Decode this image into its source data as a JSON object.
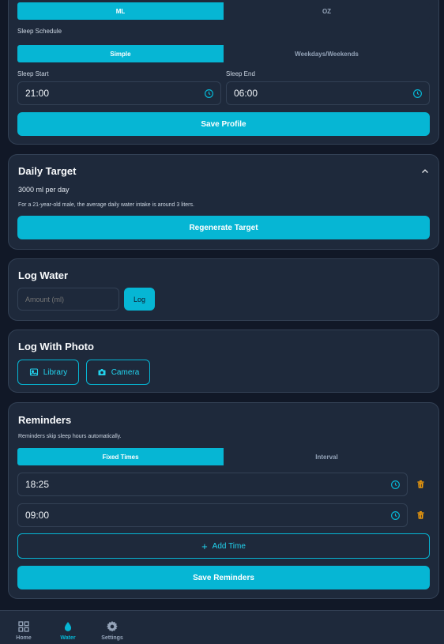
{
  "profile": {
    "units": {
      "options": [
        "ML",
        "OZ"
      ],
      "selected": "ML"
    },
    "sleep_schedule_label": "Sleep Schedule",
    "sleep_schedule": {
      "options": [
        "Simple",
        "Weekdays/Weekends"
      ],
      "selected": "Simple"
    },
    "sleep_start_label": "Sleep Start",
    "sleep_start_value": "21:00",
    "sleep_end_label": "Sleep End",
    "sleep_end_value": "06:00",
    "save_label": "Save Profile"
  },
  "daily_target": {
    "title": "Daily Target",
    "amount_text": "3000 ml per day",
    "note": "For a 21-year-old male, the average daily water intake is around 3 liters.",
    "regenerate_label": "Regenerate Target"
  },
  "log_water": {
    "title": "Log Water",
    "amount_placeholder": "Amount (ml)",
    "log_label": "Log"
  },
  "log_photo": {
    "title": "Log With Photo",
    "library_label": "Library",
    "camera_label": "Camera"
  },
  "reminders": {
    "title": "Reminders",
    "note": "Reminders skip sleep hours automatically.",
    "mode": {
      "options": [
        "Fixed Times",
        "Interval"
      ],
      "selected": "Fixed Times"
    },
    "times": [
      "18:25",
      "09:00"
    ],
    "add_time_label": "Add Time",
    "save_label": "Save Reminders"
  },
  "nav": {
    "items": [
      {
        "label": "Home",
        "icon": "grid-icon"
      },
      {
        "label": "Water",
        "icon": "water-drop-icon"
      },
      {
        "label": "Settings",
        "icon": "gear-icon"
      }
    ],
    "active": "Water"
  },
  "colors": {
    "accent": "#06b6d4",
    "background": "#111827",
    "card": "#1e293b",
    "danger": "#f59e0b"
  }
}
